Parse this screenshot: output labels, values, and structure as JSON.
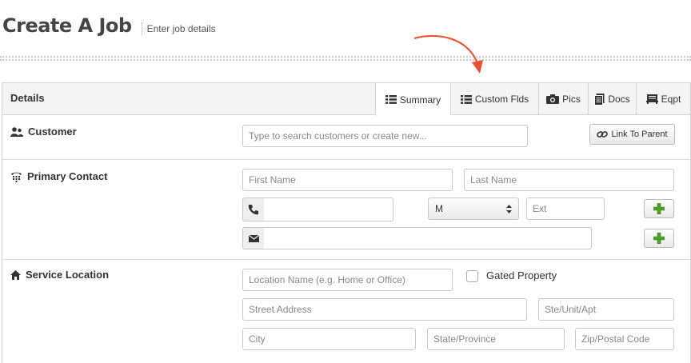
{
  "header": {
    "title": "Create A Job",
    "subtitle": "Enter job details"
  },
  "colors": {
    "accent_arrow": "#e8502e",
    "plus_green": "#4ea02a"
  },
  "panel": {
    "title": "Details",
    "tabs": [
      {
        "label": "Summary",
        "icon": "list-icon"
      },
      {
        "label": "Custom Flds",
        "icon": "list-icon"
      },
      {
        "label": "Pics",
        "icon": "camera-icon"
      },
      {
        "label": "Docs",
        "icon": "document-icon"
      },
      {
        "label": "Eqpt",
        "icon": "equipment-icon"
      }
    ]
  },
  "customer": {
    "label": "Customer",
    "search_placeholder": "Type to search customers or create new...",
    "link_parent_label": "Link To Parent"
  },
  "primary_contact": {
    "label": "Primary Contact",
    "first_name_placeholder": "First Name",
    "last_name_placeholder": "Last Name",
    "phone_type_value": "M",
    "ext_placeholder": "Ext"
  },
  "service_location": {
    "label": "Service Location",
    "location_name_placeholder": "Location Name (e.g. Home or Office)",
    "gated_label": "Gated Property",
    "street_placeholder": "Street Address",
    "unit_placeholder": "Ste/Unit/Apt",
    "city_placeholder": "City",
    "state_placeholder": "State/Province",
    "zip_placeholder": "Zip/Postal Code"
  }
}
